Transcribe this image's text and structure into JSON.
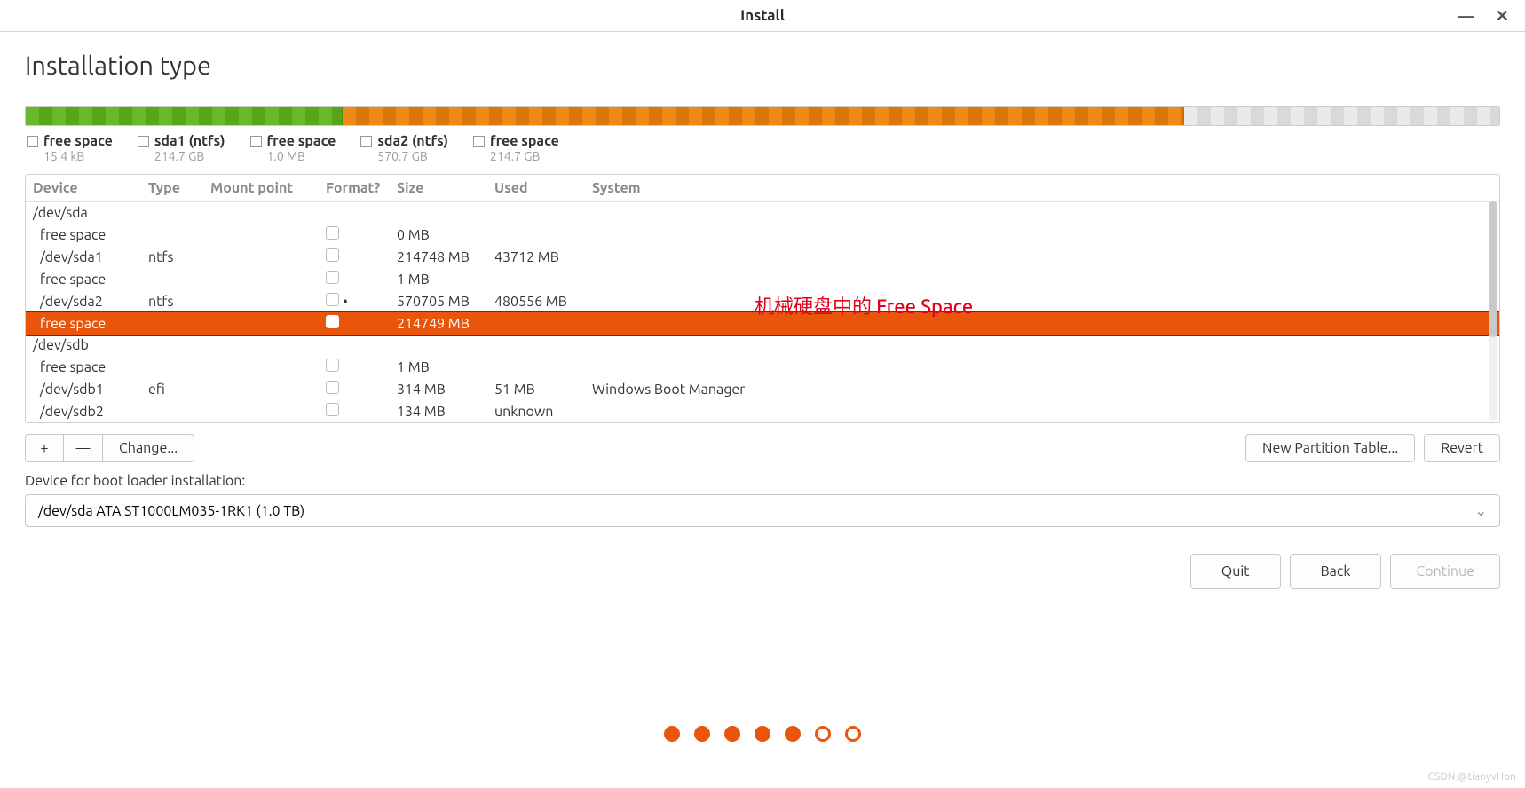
{
  "window": {
    "title": "Install"
  },
  "header": {
    "page_title": "Installation type"
  },
  "usage_bar": {
    "segments": [
      {
        "cls": "seg-green",
        "pct": 21.5
      },
      {
        "cls": "seg-orange",
        "pct": 57.1
      },
      {
        "cls": "seg-gray",
        "pct": 21.4
      }
    ]
  },
  "legend": {
    "items": [
      {
        "swatch": "",
        "name": "free space",
        "size": "15.4 kB"
      },
      {
        "swatch": "sw-green",
        "name": "sda1 (ntfs)",
        "size": "214.7 GB"
      },
      {
        "swatch": "",
        "name": "free space",
        "size": "1.0 MB"
      },
      {
        "swatch": "sw-orange",
        "name": "sda2 (ntfs)",
        "size": "570.7 GB"
      },
      {
        "swatch": "",
        "name": "free space",
        "size": "214.7 GB"
      }
    ]
  },
  "table": {
    "columns": {
      "device": "Device",
      "type": "Type",
      "mount": "Mount point",
      "format": "Format?",
      "size": "Size",
      "used": "Used",
      "system": "System"
    },
    "rows": [
      {
        "kind": "disk",
        "device": "/dev/sda"
      },
      {
        "kind": "part",
        "device": "free space",
        "size": "0 MB",
        "format_box": true
      },
      {
        "kind": "part",
        "device": "/dev/sda1",
        "type": "ntfs",
        "size": "214748 MB",
        "used": "43712 MB",
        "format_box": true
      },
      {
        "kind": "part",
        "device": "free space",
        "size": "1 MB",
        "format_box": true
      },
      {
        "kind": "part",
        "device": "/dev/sda2",
        "type": "ntfs",
        "size": "570705 MB",
        "used": "480556 MB",
        "format_box": true,
        "partial": true
      },
      {
        "kind": "part",
        "device": "free space",
        "size": "214749 MB",
        "format_box": true,
        "selected": true
      },
      {
        "kind": "disk",
        "device": "/dev/sdb"
      },
      {
        "kind": "part",
        "device": "free space",
        "size": "1 MB",
        "format_box": true
      },
      {
        "kind": "part",
        "device": "/dev/sdb1",
        "type": "efi",
        "size": "314 MB",
        "used": "51 MB",
        "system": "Windows Boot Manager",
        "format_box": true
      },
      {
        "kind": "part",
        "device": "/dev/sdb2",
        "size": "134 MB",
        "used": "unknown",
        "format_box": true
      }
    ]
  },
  "annotation": {
    "text": "机械硬盘中的 Free Space"
  },
  "actions": {
    "add": "+",
    "remove": "—",
    "change": "Change...",
    "new_table": "New Partition Table...",
    "revert": "Revert"
  },
  "boot_loader": {
    "label": "Device for boot loader installation:",
    "selected": "/dev/sda   ATA ST1000LM035-1RK1 (1.0 TB)"
  },
  "dialog_buttons": {
    "quit": "Quit",
    "back": "Back",
    "continue": "Continue"
  },
  "pager": {
    "total": 7,
    "filled": 5
  },
  "watermark": "CSDN @tianyvHon"
}
